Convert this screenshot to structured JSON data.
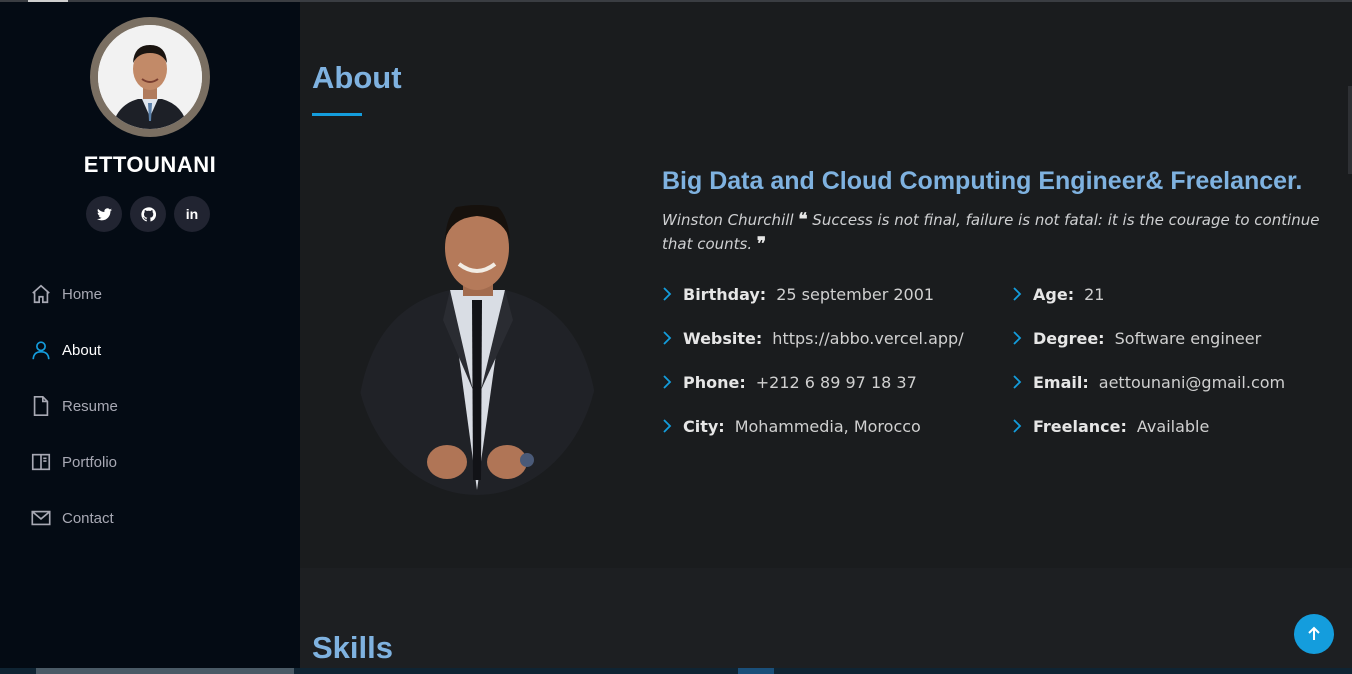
{
  "sidebar": {
    "name": "ETTOUNANI",
    "socials": [
      {
        "icon": "twitter-icon"
      },
      {
        "icon": "github-icon"
      },
      {
        "icon": "linkedin-icon",
        "label": "in"
      }
    ],
    "nav": [
      {
        "label": "Home",
        "icon": "home-icon"
      },
      {
        "label": "About",
        "icon": "user-icon",
        "active": true
      },
      {
        "label": "Resume",
        "icon": "file-icon"
      },
      {
        "label": "Portfolio",
        "icon": "book-icon"
      },
      {
        "label": "Contact",
        "icon": "envelope-icon"
      }
    ]
  },
  "about": {
    "title": "About",
    "headline": "Big Data and Cloud Computing Engineer& Freelancer.",
    "quote_author": "Winston Churchill",
    "quote_text": "Success is not final, failure is not fatal: it is the courage to continue that counts.",
    "info_left": [
      {
        "label": "Birthday:",
        "value": "25 september 2001"
      },
      {
        "label": "Website:",
        "value": "https://abbo.vercel.app/"
      },
      {
        "label": "Phone:",
        "value": "+212 6 89 97 18 37"
      },
      {
        "label": "City:",
        "value": "Mohammedia, Morocco"
      }
    ],
    "info_right": [
      {
        "label": "Age:",
        "value": "21"
      },
      {
        "label": "Degree:",
        "value": "Software engineer"
      },
      {
        "label": "Email:",
        "value": "aettounani@gmail.com"
      },
      {
        "label": "Freelance:",
        "value": "Available"
      }
    ]
  },
  "skills": {
    "title": "Skills"
  },
  "colors": {
    "accent": "#149ddd",
    "heading": "#7fb2e0",
    "sidebar_bg": "#040b14",
    "main_bg": "#1a1c1e"
  }
}
